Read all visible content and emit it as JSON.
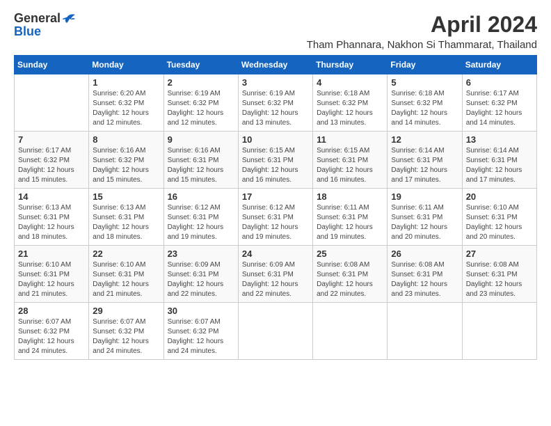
{
  "header": {
    "logo_general": "General",
    "logo_blue": "Blue",
    "main_title": "April 2024",
    "subtitle": "Tham Phannara, Nakhon Si Thammarat, Thailand"
  },
  "days_of_week": [
    "Sunday",
    "Monday",
    "Tuesday",
    "Wednesday",
    "Thursday",
    "Friday",
    "Saturday"
  ],
  "weeks": [
    [
      {
        "num": "",
        "sunrise": "",
        "sunset": "",
        "daylight": ""
      },
      {
        "num": "1",
        "sunrise": "Sunrise: 6:20 AM",
        "sunset": "Sunset: 6:32 PM",
        "daylight": "Daylight: 12 hours and 12 minutes."
      },
      {
        "num": "2",
        "sunrise": "Sunrise: 6:19 AM",
        "sunset": "Sunset: 6:32 PM",
        "daylight": "Daylight: 12 hours and 12 minutes."
      },
      {
        "num": "3",
        "sunrise": "Sunrise: 6:19 AM",
        "sunset": "Sunset: 6:32 PM",
        "daylight": "Daylight: 12 hours and 13 minutes."
      },
      {
        "num": "4",
        "sunrise": "Sunrise: 6:18 AM",
        "sunset": "Sunset: 6:32 PM",
        "daylight": "Daylight: 12 hours and 13 minutes."
      },
      {
        "num": "5",
        "sunrise": "Sunrise: 6:18 AM",
        "sunset": "Sunset: 6:32 PM",
        "daylight": "Daylight: 12 hours and 14 minutes."
      },
      {
        "num": "6",
        "sunrise": "Sunrise: 6:17 AM",
        "sunset": "Sunset: 6:32 PM",
        "daylight": "Daylight: 12 hours and 14 minutes."
      }
    ],
    [
      {
        "num": "7",
        "sunrise": "Sunrise: 6:17 AM",
        "sunset": "Sunset: 6:32 PM",
        "daylight": "Daylight: 12 hours and 15 minutes."
      },
      {
        "num": "8",
        "sunrise": "Sunrise: 6:16 AM",
        "sunset": "Sunset: 6:32 PM",
        "daylight": "Daylight: 12 hours and 15 minutes."
      },
      {
        "num": "9",
        "sunrise": "Sunrise: 6:16 AM",
        "sunset": "Sunset: 6:31 PM",
        "daylight": "Daylight: 12 hours and 15 minutes."
      },
      {
        "num": "10",
        "sunrise": "Sunrise: 6:15 AM",
        "sunset": "Sunset: 6:31 PM",
        "daylight": "Daylight: 12 hours and 16 minutes."
      },
      {
        "num": "11",
        "sunrise": "Sunrise: 6:15 AM",
        "sunset": "Sunset: 6:31 PM",
        "daylight": "Daylight: 12 hours and 16 minutes."
      },
      {
        "num": "12",
        "sunrise": "Sunrise: 6:14 AM",
        "sunset": "Sunset: 6:31 PM",
        "daylight": "Daylight: 12 hours and 17 minutes."
      },
      {
        "num": "13",
        "sunrise": "Sunrise: 6:14 AM",
        "sunset": "Sunset: 6:31 PM",
        "daylight": "Daylight: 12 hours and 17 minutes."
      }
    ],
    [
      {
        "num": "14",
        "sunrise": "Sunrise: 6:13 AM",
        "sunset": "Sunset: 6:31 PM",
        "daylight": "Daylight: 12 hours and 18 minutes."
      },
      {
        "num": "15",
        "sunrise": "Sunrise: 6:13 AM",
        "sunset": "Sunset: 6:31 PM",
        "daylight": "Daylight: 12 hours and 18 minutes."
      },
      {
        "num": "16",
        "sunrise": "Sunrise: 6:12 AM",
        "sunset": "Sunset: 6:31 PM",
        "daylight": "Daylight: 12 hours and 19 minutes."
      },
      {
        "num": "17",
        "sunrise": "Sunrise: 6:12 AM",
        "sunset": "Sunset: 6:31 PM",
        "daylight": "Daylight: 12 hours and 19 minutes."
      },
      {
        "num": "18",
        "sunrise": "Sunrise: 6:11 AM",
        "sunset": "Sunset: 6:31 PM",
        "daylight": "Daylight: 12 hours and 19 minutes."
      },
      {
        "num": "19",
        "sunrise": "Sunrise: 6:11 AM",
        "sunset": "Sunset: 6:31 PM",
        "daylight": "Daylight: 12 hours and 20 minutes."
      },
      {
        "num": "20",
        "sunrise": "Sunrise: 6:10 AM",
        "sunset": "Sunset: 6:31 PM",
        "daylight": "Daylight: 12 hours and 20 minutes."
      }
    ],
    [
      {
        "num": "21",
        "sunrise": "Sunrise: 6:10 AM",
        "sunset": "Sunset: 6:31 PM",
        "daylight": "Daylight: 12 hours and 21 minutes."
      },
      {
        "num": "22",
        "sunrise": "Sunrise: 6:10 AM",
        "sunset": "Sunset: 6:31 PM",
        "daylight": "Daylight: 12 hours and 21 minutes."
      },
      {
        "num": "23",
        "sunrise": "Sunrise: 6:09 AM",
        "sunset": "Sunset: 6:31 PM",
        "daylight": "Daylight: 12 hours and 22 minutes."
      },
      {
        "num": "24",
        "sunrise": "Sunrise: 6:09 AM",
        "sunset": "Sunset: 6:31 PM",
        "daylight": "Daylight: 12 hours and 22 minutes."
      },
      {
        "num": "25",
        "sunrise": "Sunrise: 6:08 AM",
        "sunset": "Sunset: 6:31 PM",
        "daylight": "Daylight: 12 hours and 22 minutes."
      },
      {
        "num": "26",
        "sunrise": "Sunrise: 6:08 AM",
        "sunset": "Sunset: 6:31 PM",
        "daylight": "Daylight: 12 hours and 23 minutes."
      },
      {
        "num": "27",
        "sunrise": "Sunrise: 6:08 AM",
        "sunset": "Sunset: 6:31 PM",
        "daylight": "Daylight: 12 hours and 23 minutes."
      }
    ],
    [
      {
        "num": "28",
        "sunrise": "Sunrise: 6:07 AM",
        "sunset": "Sunset: 6:32 PM",
        "daylight": "Daylight: 12 hours and 24 minutes."
      },
      {
        "num": "29",
        "sunrise": "Sunrise: 6:07 AM",
        "sunset": "Sunset: 6:32 PM",
        "daylight": "Daylight: 12 hours and 24 minutes."
      },
      {
        "num": "30",
        "sunrise": "Sunrise: 6:07 AM",
        "sunset": "Sunset: 6:32 PM",
        "daylight": "Daylight: 12 hours and 24 minutes."
      },
      {
        "num": "",
        "sunrise": "",
        "sunset": "",
        "daylight": ""
      },
      {
        "num": "",
        "sunrise": "",
        "sunset": "",
        "daylight": ""
      },
      {
        "num": "",
        "sunrise": "",
        "sunset": "",
        "daylight": ""
      },
      {
        "num": "",
        "sunrise": "",
        "sunset": "",
        "daylight": ""
      }
    ]
  ]
}
